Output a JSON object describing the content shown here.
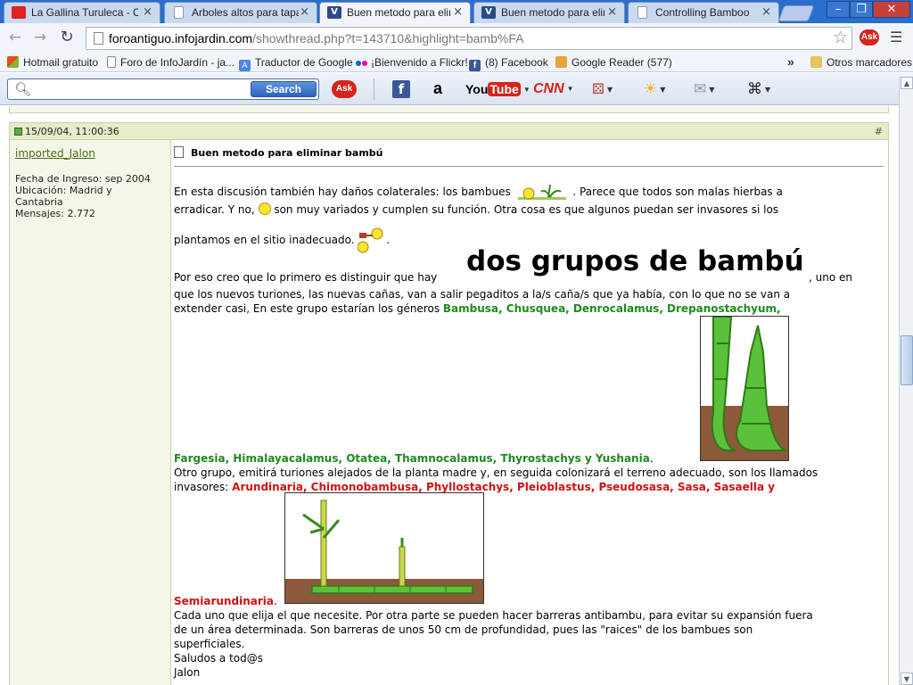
{
  "browser": {
    "tabs": [
      {
        "title": "La Gallina Turuleca - Can",
        "icon": "youtube-icon"
      },
      {
        "title": "Arboles altos para tapar",
        "icon": "page-icon"
      },
      {
        "title": "Buen metodo para elimin",
        "icon": "infojardin-icon",
        "active": true
      },
      {
        "title": "Buen metodo para elimin",
        "icon": "infojardin-icon"
      },
      {
        "title": "Controlling Bamboo",
        "icon": "page-icon"
      }
    ],
    "url_host": "foroantiguo.infojardin.com",
    "url_path": "/showthread.php?t=143710&highlight=bamb%FA",
    "bookmarks": [
      "Hotmail gratuito",
      "Foro de InfoJardín - ja...",
      "Traductor de Google",
      "¡Bienvenido a Flickr!",
      "(8) Facebook",
      "Google Reader (577)"
    ],
    "bookmarks_more": "»",
    "other_bookmarks": "Otros marcadores"
  },
  "asktoolbar": {
    "search_placeholder": "",
    "search_button": "Search",
    "ask_label": "Ask",
    "youtube_you": "You",
    "youtube_tube": "Tube",
    "cnn_label": "CNN",
    "amazon_label": "a"
  },
  "post": {
    "date": "15/09/04, 11:00:36",
    "number": "#",
    "username": "imported_Jalon",
    "join_date": "Fecha de Ingreso: sep 2004",
    "location_1": "Ubicación: Madrid y",
    "location_2": "Cantabria",
    "messages": "Mensajes: 2.772",
    "title": "Buen metodo para eliminar bambú",
    "p1_a": "En esta discusión también hay daños colaterales: los bambues",
    "p1_b": ". Parece que todos son malas hierbas a",
    "p1_c": "erradicar. Y no,",
    "p1_d": "son muy variados y cumplen su función. Otra cosa es que algunos puedan ser invasores si los",
    "p1_e": "plantamos en el sitio inadecuado.",
    "p1_e_end": ".",
    "p2_a": "Por eso creo que lo primero es distinguir que hay",
    "p2_big": "dos grupos de bambú",
    "p2_b": ", uno en",
    "p2_c": "que los nuevos turiones, las nuevas cañas, van a salir pegaditos a la/s caña/s que ya había, con lo que no se van a",
    "p2_d": "extender casi, En este grupo estarían los géneros",
    "green_1": "Bambusa, Chusquea, Denrocalamus, Drepanostachyum,",
    "green_2": "Fargesia, Himalayacalamus, Otatea, Thamnocalamus, Thyrostachys y Yushania",
    "green_2_end": ".",
    "p3_a": "Otro grupo, emitirá turiones alejados de la planta madre y, en seguida colonizará el terreno adecuado, son los llamados",
    "p3_b": "invasores:",
    "red_1": "Arundinaria, Chimonobambusa, Phyllostachys, Pleioblastus, Pseudosasa, Sasa, Sasaella y",
    "red_2": "Semiarundinaria",
    "red_2_end": ".",
    "p4_a": "Cada uno que elija el que necesite. Por otra parte se pueden hacer barreras antibambu, para evitar su expansión fuera",
    "p4_b": "de un área determinada. Son barreras de unos 50 cm de profundidad, pues las \"raices\" de los bambues son",
    "p4_c": "superficiales.",
    "p5": "Saludos a tod@s",
    "signature": "Jalon"
  },
  "colors": {
    "green_genus": "#1f8a1f",
    "red_genus": "#d01010",
    "post_header": "#e7ecc9"
  }
}
